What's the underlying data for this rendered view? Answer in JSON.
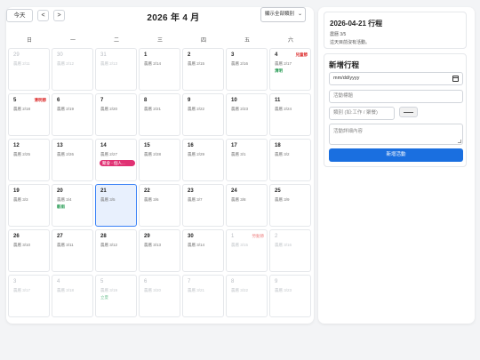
{
  "calendar": {
    "today_label": "今天",
    "prev_label": "<",
    "next_label": ">",
    "month_title": "2026 年 4 月",
    "filter_value": "顯示全部類別",
    "weekdays": [
      "日",
      "一",
      "二",
      "三",
      "四",
      "五",
      "六"
    ],
    "weeks": [
      [
        {
          "d": "29",
          "l": "農曆 2/11",
          "other": true
        },
        {
          "d": "30",
          "l": "農曆 2/12",
          "other": true
        },
        {
          "d": "31",
          "l": "農曆 2/13",
          "other": true
        },
        {
          "d": "1",
          "l": "農曆 2/14"
        },
        {
          "d": "2",
          "l": "農曆 2/15"
        },
        {
          "d": "3",
          "l": "農曆 2/16"
        },
        {
          "d": "4",
          "l": "農曆 2/17",
          "holiday": "兒童節",
          "tag": "清明"
        }
      ],
      [
        {
          "d": "5",
          "l": "農曆 2/18",
          "holiday": "清明節"
        },
        {
          "d": "6",
          "l": "農曆 2/19"
        },
        {
          "d": "7",
          "l": "農曆 2/20"
        },
        {
          "d": "8",
          "l": "農曆 2/21"
        },
        {
          "d": "9",
          "l": "農曆 2/22"
        },
        {
          "d": "10",
          "l": "農曆 2/23"
        },
        {
          "d": "11",
          "l": "農曆 2/24"
        }
      ],
      [
        {
          "d": "12",
          "l": "農曆 2/25"
        },
        {
          "d": "13",
          "l": "農曆 2/26"
        },
        {
          "d": "14",
          "l": "農曆 2/27",
          "event": "聚會 - 個人..."
        },
        {
          "d": "15",
          "l": "農曆 2/28"
        },
        {
          "d": "16",
          "l": "農曆 2/29"
        },
        {
          "d": "17",
          "l": "農曆 3/1"
        },
        {
          "d": "18",
          "l": "農曆 3/2"
        }
      ],
      [
        {
          "d": "19",
          "l": "農曆 3/3"
        },
        {
          "d": "20",
          "l": "農曆 3/4",
          "tag": "穀雨"
        },
        {
          "d": "21",
          "l": "農曆 3/5",
          "today": true
        },
        {
          "d": "22",
          "l": "農曆 3/6"
        },
        {
          "d": "23",
          "l": "農曆 3/7"
        },
        {
          "d": "24",
          "l": "農曆 3/8"
        },
        {
          "d": "25",
          "l": "農曆 3/9"
        }
      ],
      [
        {
          "d": "26",
          "l": "農曆 3/10"
        },
        {
          "d": "27",
          "l": "農曆 3/11"
        },
        {
          "d": "28",
          "l": "農曆 3/12"
        },
        {
          "d": "29",
          "l": "農曆 3/13"
        },
        {
          "d": "30",
          "l": "農曆 3/14"
        },
        {
          "d": "1",
          "l": "農曆 3/15",
          "other": true,
          "holiday": "勞動節"
        },
        {
          "d": "2",
          "l": "農曆 3/16",
          "other": true
        }
      ],
      [
        {
          "d": "3",
          "l": "農曆 3/17",
          "other": true
        },
        {
          "d": "4",
          "l": "農曆 3/18",
          "other": true
        },
        {
          "d": "5",
          "l": "農曆 3/19",
          "other": true,
          "tag": "立夏"
        },
        {
          "d": "6",
          "l": "農曆 3/20",
          "other": true
        },
        {
          "d": "7",
          "l": "農曆 3/21",
          "other": true
        },
        {
          "d": "8",
          "l": "農曆 3/22",
          "other": true
        },
        {
          "d": "9",
          "l": "農曆 3/23",
          "other": true
        }
      ]
    ]
  },
  "sidebar": {
    "selected_date": "2026-04-21 行程",
    "selected_lunar": "農曆 3/5",
    "no_events": "這天目前沒有活動。",
    "form": {
      "title": "新增行程",
      "date_placeholder": "mm/dd/yyyy",
      "title_placeholder": "活動標題",
      "category_placeholder": "類別 (如:工作 / 聚餐)",
      "description_placeholder": "活動詳細內容",
      "submit_label": "新增活動"
    }
  },
  "colors": {
    "accent": "#1a6fe0",
    "today_bg": "#e8f0fd",
    "event_bg": "#e03173",
    "holiday": "#dd3333",
    "solar_term": "#2a9d56"
  }
}
